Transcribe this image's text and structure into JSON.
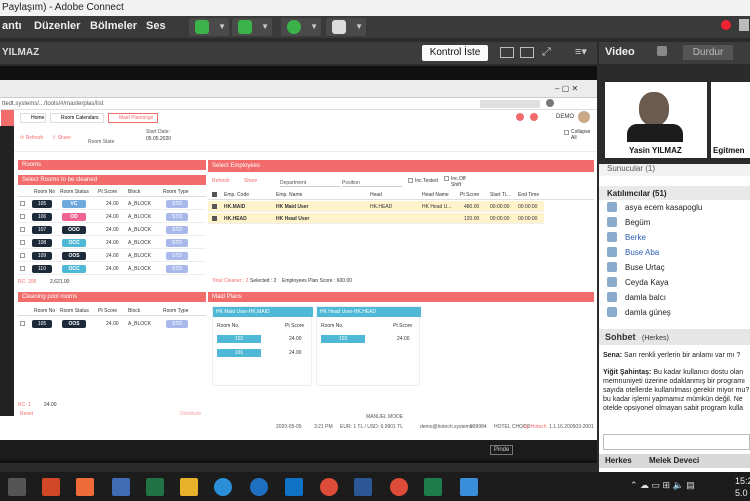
{
  "window": {
    "title": "Paylaşım) - Adobe Connect"
  },
  "menubar": {
    "items": [
      "antı",
      "Düzenler",
      "Bölmeler",
      "Ses"
    ]
  },
  "pod": {
    "title": "YILMAZ",
    "control_button": "Kontrol İste"
  },
  "browser": {
    "url": "ttedt.systems/.../tools/#/masterplas/list",
    "tabs": [
      "Home",
      "Room Calendars",
      "Maid Plannings"
    ],
    "toolbar": {
      "refresh": "Refresh",
      "share": "Share",
      "start_date_label": "Start Date:",
      "start_date": "05.05.2020",
      "room_state": "Room State",
      "collapse_all": "Collapse All"
    },
    "user": "DEMO"
  },
  "rooms": {
    "title": "Rooms",
    "subtitle": "Select Rooms to be cleaned",
    "columns": [
      "Room No",
      "Room Status",
      "Pt Score",
      "Block",
      "Room Type"
    ],
    "rows": [
      {
        "no": "105",
        "status": "VC",
        "score": "24.00",
        "block": "A_BLOCK",
        "type": "STD",
        "status_color": "#6fa8dc"
      },
      {
        "no": "106",
        "status": "OD",
        "score": "24.00",
        "block": "A_BLOCK",
        "type": "STD",
        "status_color": "#f06292"
      },
      {
        "no": "107",
        "status": "OOO",
        "score": "24.00",
        "block": "A_BLOCK",
        "type": "STD",
        "status_color": "#1d2a3a"
      },
      {
        "no": "108",
        "status": "OCC",
        "score": "24.00",
        "block": "A_BLOCK",
        "type": "STD",
        "status_color": "#4fb8d6"
      },
      {
        "no": "109",
        "status": "OOS",
        "score": "24.00",
        "block": "A_BLOCK",
        "type": "STD",
        "status_color": "#1d2a3a"
      },
      {
        "no": "110",
        "status": "OCC",
        "score": "24.00",
        "block": "A_BLOCK",
        "type": "STD",
        "status_color": "#4fb8d6"
      }
    ],
    "footer_count": "RC: 205",
    "footer_score": "2,621.00"
  },
  "cleaning_pool": {
    "title": "Cleaning pool rooms",
    "columns": [
      "Room No",
      "Room Status",
      "Pt Score",
      "Block",
      "Room Type"
    ],
    "rows": [
      {
        "no": "105",
        "status": "OOS",
        "score": "24.00",
        "block": "A_BLOCK",
        "type": "STD"
      }
    ],
    "footer_count": "RC: 1",
    "footer_score": "24.00",
    "reset": "Reset",
    "distribute": "Distribute"
  },
  "employees": {
    "title": "Select Employees",
    "refresh": "Refresh",
    "share": "Share",
    "department": "Department",
    "position": "Position",
    "inc_tested": "Inc.Tested",
    "inc_off_shift": "Inc.Off Shift",
    "columns": [
      "Emp. Code",
      "Emp. Name",
      "Head",
      "Head Name",
      "Pt Score",
      "Start Ti...",
      "End Time"
    ],
    "rows": [
      {
        "code": "HK.MAID",
        "name": "HK Maid User",
        "head": "HK.HEAD",
        "head_name": "HK Head U...",
        "score": "480.00",
        "start": "00:00:00",
        "end": "00:00:00"
      },
      {
        "code": "HK.HEAD",
        "name": "HK Head User",
        "head": "",
        "head_name": "",
        "score": "120.00",
        "start": "00:00:00",
        "end": "00:00:00"
      }
    ],
    "footer": {
      "total_cleaner": "Total Cleaner : 2",
      "selected": "Selected : 2",
      "emp_plan_score": "Employees Plan Score : 600.00"
    }
  },
  "maid_plans": {
    "title": "Maid Plans",
    "cards": [
      {
        "title": "HK Maid User-HK.MAID",
        "col_room": "Room No.",
        "col_score": "Pt Score",
        "rows": [
          {
            "no": "102",
            "score": "24.00"
          },
          {
            "no": "101",
            "score": "24.00"
          }
        ]
      },
      {
        "title": "HK Head User-HK.HEAD",
        "col_room": "Room No.",
        "col_score": "Pt Score",
        "rows": [
          {
            "no": "103",
            "score": "24.00"
          }
        ]
      }
    ]
  },
  "app_status": {
    "date": "2020-05-05",
    "time": "3:21 PM",
    "currency": "EUR: 1 TL / USD: 6.9901 TL",
    "email": "demo@hotech.systems",
    "code": "999984",
    "hotel": "HOTEL CHOCO",
    "by": "by Hotech",
    "version": "1.1.16.200503-2001",
    "manual_mode": "MANUEL MODE",
    "lang": "Pinde"
  },
  "right_panel": {
    "video_title": "Video",
    "stop_button": "Durdur",
    "presenter_name": "Yasin YILMAZ",
    "second_name": "Egitmen",
    "sunucular": "Sunucular (1)",
    "katilimcilar": "Katılımcılar (51)",
    "participants": [
      "asya ecem kasapoglu",
      "Begüm",
      "Berke",
      "Buse Aba",
      "Buse Urtaç",
      "Ceyda Kaya",
      "damla balcı",
      "damla güneş"
    ],
    "chat_title": "Sohbet",
    "chat_subtitle": "(Herkes)",
    "chat_msg1_author": "Sena:",
    "chat_msg1_text": "Sarı renkli yerlerin bir anlamı var mı ?",
    "chat_msg2_author": "Yiğit Şahintaş:",
    "chat_msg2_lines": [
      "Bu kadar kullanıcı dostu olan",
      "memnuniyeti üzerine odaklanmış bir programı",
      "sayıda otellerde kullanılması gerekir miyor mu?",
      "bu kadar işlemi yapmamız mümkün değil. Ne",
      "otelde opsiyonel olmayan sabit program kulla"
    ],
    "tab_everyone": "Herkes",
    "tab_melek": "Melek Deveci"
  },
  "taskbar": {
    "time": "15:2",
    "date": "5.0"
  },
  "colors": {
    "accent": "#f26c6c",
    "highlight_row": "#fff3cc",
    "header_blue": "#4fb8d6"
  }
}
